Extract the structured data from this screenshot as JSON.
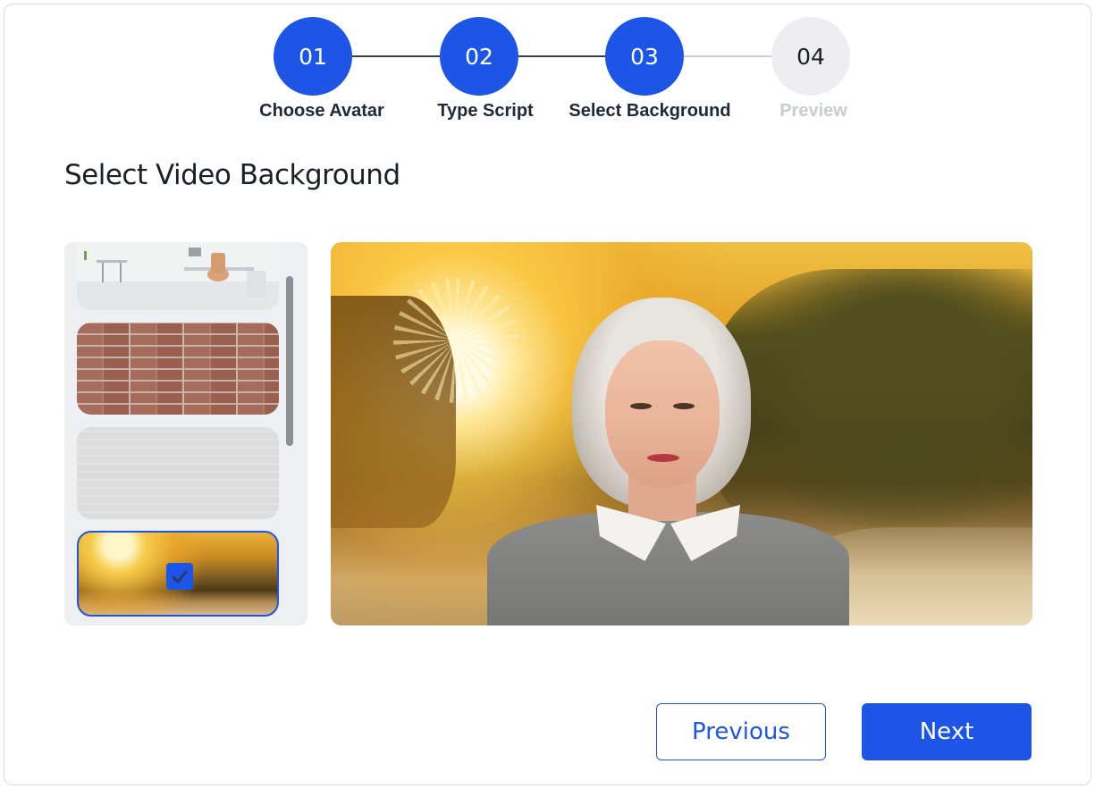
{
  "stepper": {
    "steps": [
      {
        "number": "01",
        "label": "Choose Avatar",
        "state": "done"
      },
      {
        "number": "02",
        "label": "Type Script",
        "state": "done"
      },
      {
        "number": "03",
        "label": "Select Background",
        "state": "current"
      },
      {
        "number": "04",
        "label": "Preview",
        "state": "pending"
      }
    ],
    "active_color": "#1d56e6",
    "inactive_color": "#eeeef1"
  },
  "page": {
    "title": "Select Video Background"
  },
  "backgrounds": {
    "items": [
      {
        "name": "office",
        "selected": false
      },
      {
        "name": "brick-wall",
        "selected": false
      },
      {
        "name": "white-plaster",
        "selected": false
      },
      {
        "name": "sunset-forest",
        "selected": true
      }
    ],
    "selected_icon": "checkmark-icon"
  },
  "preview": {
    "background": "sunset-forest",
    "avatar": "older-woman-avatar"
  },
  "actions": {
    "previous_label": "Previous",
    "next_label": "Next"
  }
}
